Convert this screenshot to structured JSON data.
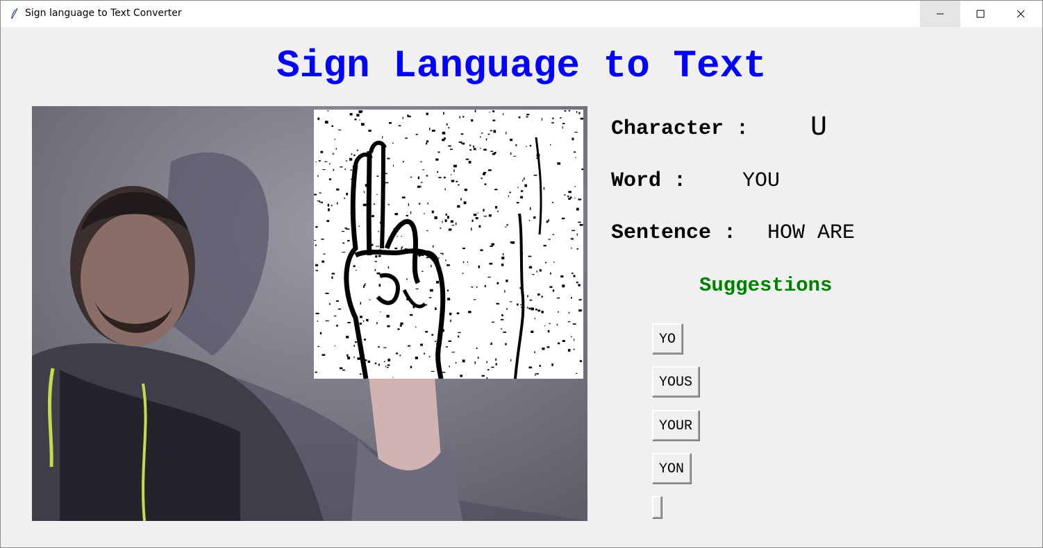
{
  "window": {
    "title": "Sign language to Text Converter"
  },
  "heading": "Sign Language to Text",
  "character": {
    "label": "Character :",
    "value": "U"
  },
  "word": {
    "label": "Word :",
    "value": "YOU"
  },
  "sentence": {
    "label": "Sentence :",
    "value": "HOW ARE"
  },
  "suggestions": {
    "title": "Suggestions",
    "items": [
      "YO",
      "YOUS",
      "YOUR",
      "YON",
      ""
    ]
  },
  "colors": {
    "heading": "#0000ff",
    "suggestions_title": "#008000",
    "background": "#f0f0f0"
  }
}
